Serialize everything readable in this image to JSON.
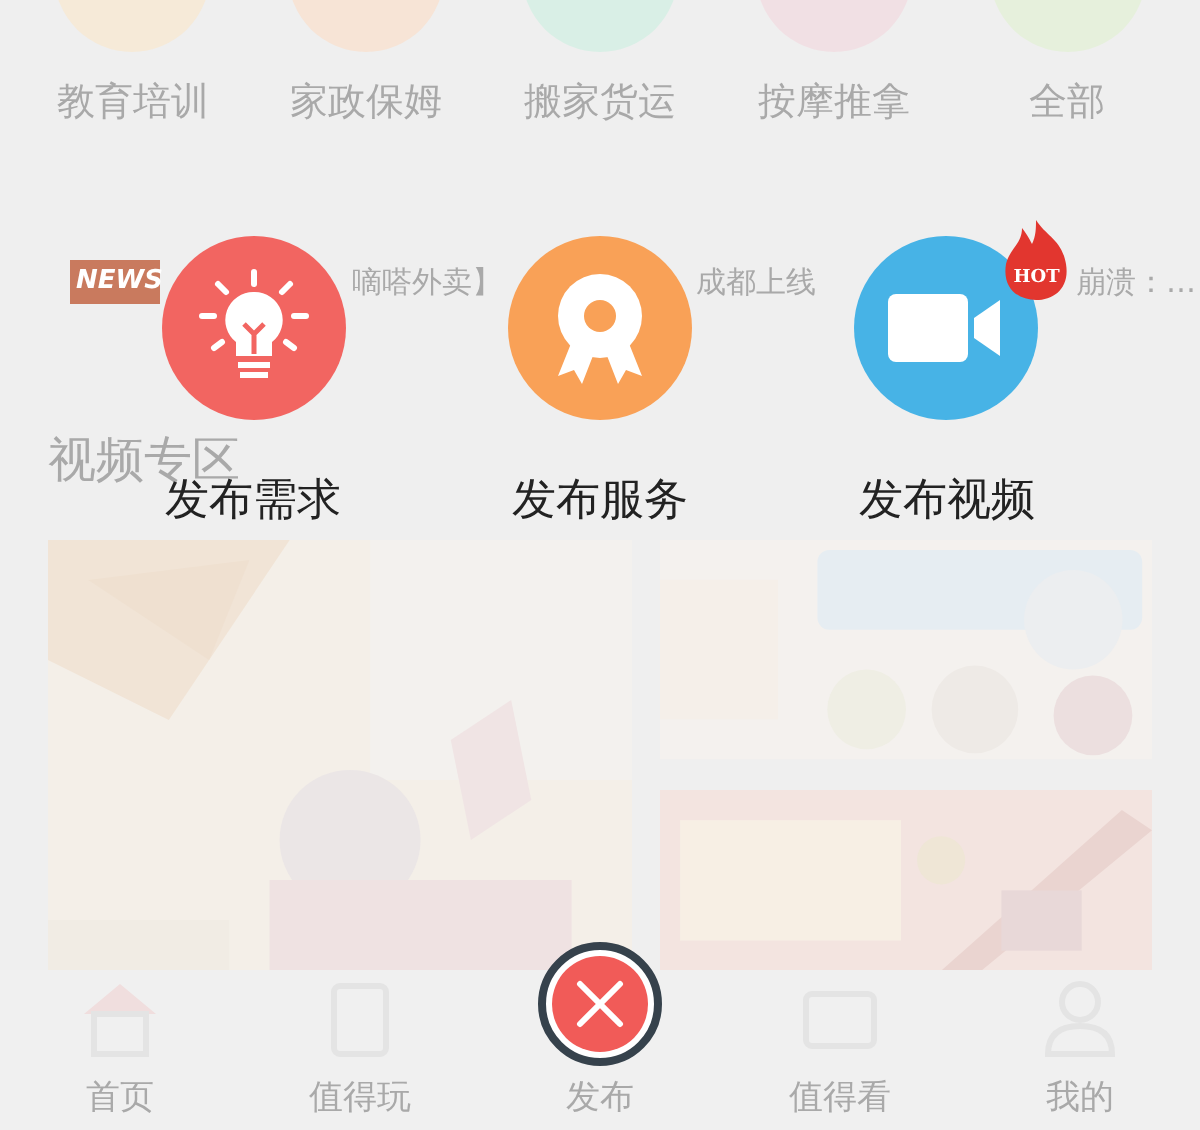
{
  "categories": [
    {
      "label": "教育培训",
      "color": "#f6ead8"
    },
    {
      "label": "家政保姆",
      "color": "#f7e4d6"
    },
    {
      "label": "搬家货运",
      "color": "#d9efe6"
    },
    {
      "label": "按摩推拿",
      "color": "#f1e0e4"
    },
    {
      "label": "全部",
      "color": "#e6f0dc"
    }
  ],
  "news": {
    "badge": "NEWS",
    "segments": [
      "嘀嗒外卖】",
      "成都上线",
      "崩溃：…"
    ]
  },
  "video_section": {
    "title": "视频专区"
  },
  "nav": [
    {
      "label": "首页",
      "kind": "home"
    },
    {
      "label": "值得玩",
      "kind": "bag"
    },
    {
      "label": "发布",
      "kind": "publish"
    },
    {
      "label": "值得看",
      "kind": "screen"
    },
    {
      "label": "我的",
      "kind": "user"
    }
  ],
  "publish_menu": {
    "actions": [
      {
        "label": "发布需求",
        "kind": "idea",
        "color": "#f26561"
      },
      {
        "label": "发布服务",
        "kind": "award",
        "color": "#f9a157"
      },
      {
        "label": "发布视频",
        "kind": "video",
        "color": "#47b3e6",
        "badge": "HOT"
      }
    ]
  }
}
